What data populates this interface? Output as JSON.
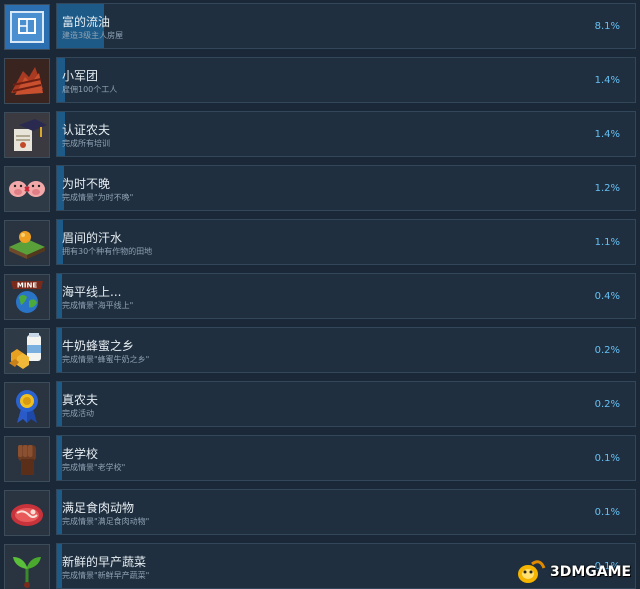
{
  "achievements": [
    {
      "title": "富的流油",
      "desc": "建造3级主人房屋",
      "pct": "8.1%",
      "progress": 8.1,
      "icon": "blueprint-icon"
    },
    {
      "title": "小军团",
      "desc": "雇佣100个工人",
      "pct": "1.4%",
      "progress": 1.4,
      "icon": "workers-icon"
    },
    {
      "title": "认证农夫",
      "desc": "完成所有培训",
      "pct": "1.4%",
      "progress": 1.4,
      "icon": "graduation-cap-icon"
    },
    {
      "title": "为时不晚",
      "desc": "完成情景\"为时不晚\"",
      "pct": "1.2%",
      "progress": 1.2,
      "icon": "pigs-icon"
    },
    {
      "title": "眉间的汗水",
      "desc": "拥有30个种有作物的田地",
      "pct": "1.1%",
      "progress": 1.1,
      "icon": "field-island-icon"
    },
    {
      "title": "海平线上...",
      "desc": "完成情景\"海平线上\"",
      "pct": "0.4%",
      "progress": 0.4,
      "icon": "mine-globe-icon"
    },
    {
      "title": "牛奶蜂蜜之乡",
      "desc": "完成情景\"蜂蜜牛奶之乡\"",
      "pct": "0.2%",
      "progress": 0.2,
      "icon": "milk-honey-icon"
    },
    {
      "title": "真农夫",
      "desc": "完成活动",
      "pct": "0.2%",
      "progress": 0.2,
      "icon": "ribbon-medal-icon"
    },
    {
      "title": "老学校",
      "desc": "完成情景\"老学校\"",
      "pct": "0.1%",
      "progress": 0.1,
      "icon": "fist-icon"
    },
    {
      "title": "满足食肉动物",
      "desc": "完成情景\"满足食肉动物\"",
      "pct": "0.1%",
      "progress": 0.1,
      "icon": "meat-icon"
    },
    {
      "title": "新鲜的早产蔬菜",
      "desc": "完成情景\"新鲜早产蔬菜\"",
      "pct": "0.1%",
      "progress": 0.1,
      "icon": "sprout-icon"
    }
  ],
  "watermark": {
    "text": "3DMGAME"
  },
  "colors": {
    "background": "#1b2838",
    "card": "#1f2f3f",
    "bar": "#1e5a87",
    "percent": "#66c0f4"
  }
}
